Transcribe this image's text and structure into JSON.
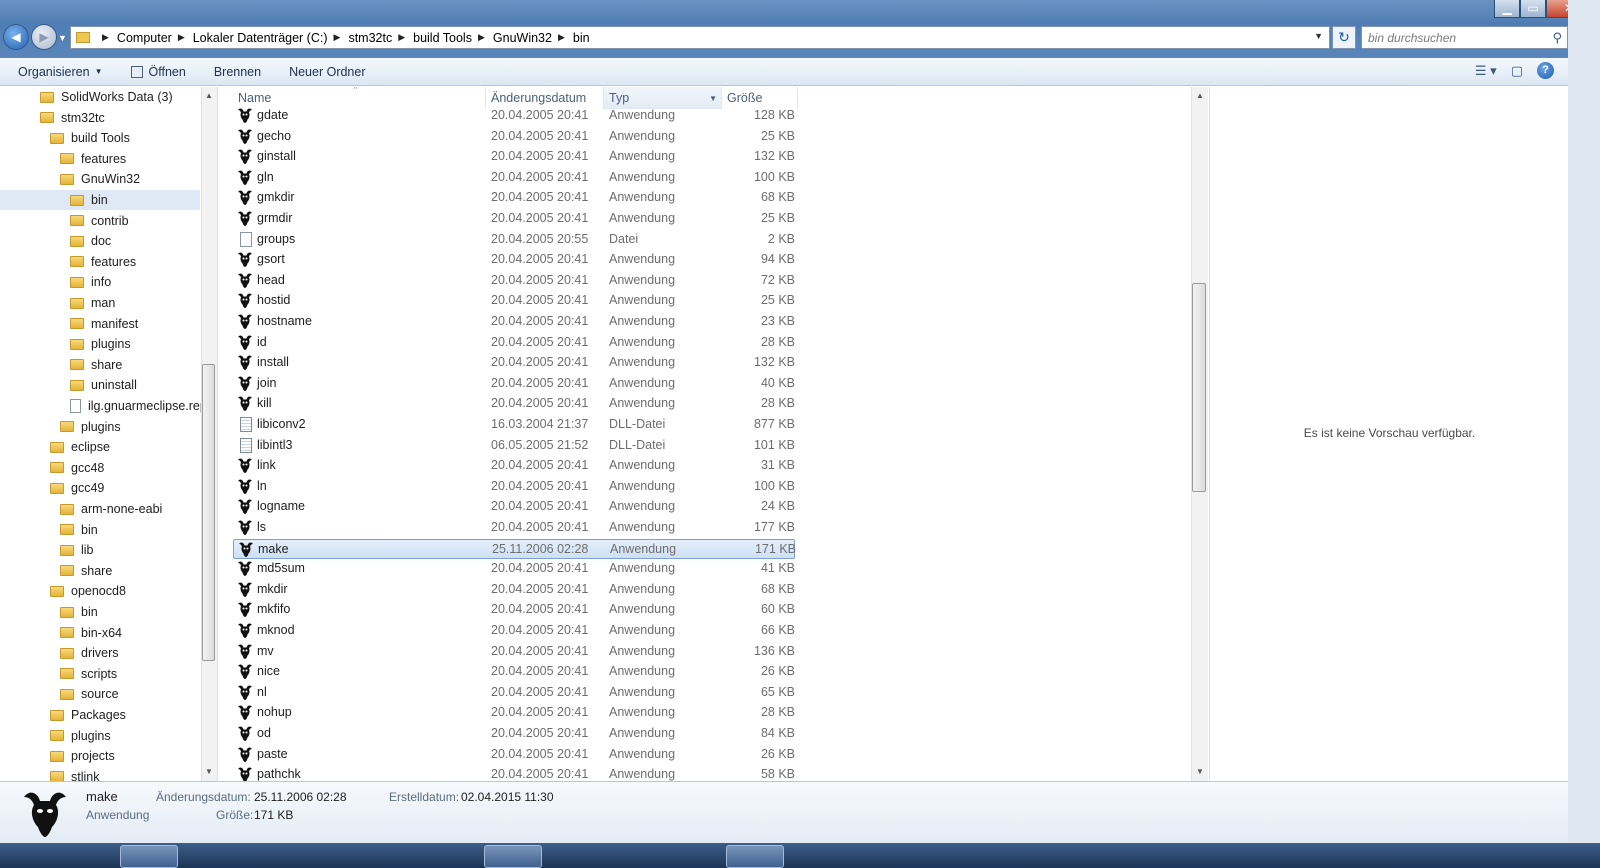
{
  "window": {
    "minimize": "▁",
    "maximize": "▭",
    "close": "✕"
  },
  "addressbar": {
    "crumbs": [
      "Computer",
      "Lokaler Datenträger (C:)",
      "stm32tc",
      "build Tools",
      "GnuWin32",
      "bin"
    ],
    "search_placeholder": "bin durchsuchen"
  },
  "toolbar": {
    "organize": "Organisieren",
    "open": "Öffnen",
    "burn": "Brennen",
    "new_folder": "Neuer Ordner"
  },
  "icons": {
    "back": "back-arrow-icon",
    "forward": "forward-arrow-icon",
    "refresh": "refresh-icon",
    "search": "search-icon",
    "views": "views-icon",
    "preview_pane": "preview-pane-icon",
    "help": "help-icon",
    "exe": "gnu-exe-icon",
    "folder": "folder-icon"
  },
  "nav_tree": [
    {
      "label": "SolidWorks Data (3)",
      "level": 0,
      "type": "folder"
    },
    {
      "label": "stm32tc",
      "level": 0,
      "type": "folder"
    },
    {
      "label": "build Tools",
      "level": 1,
      "type": "folder"
    },
    {
      "label": "features",
      "level": 2,
      "type": "folder"
    },
    {
      "label": "GnuWin32",
      "level": 2,
      "type": "folder"
    },
    {
      "label": "bin",
      "level": 3,
      "type": "folder",
      "selected": true
    },
    {
      "label": "contrib",
      "level": 3,
      "type": "folder"
    },
    {
      "label": "doc",
      "level": 3,
      "type": "folder"
    },
    {
      "label": "features",
      "level": 3,
      "type": "folder"
    },
    {
      "label": "info",
      "level": 3,
      "type": "folder"
    },
    {
      "label": "man",
      "level": 3,
      "type": "folder"
    },
    {
      "label": "manifest",
      "level": 3,
      "type": "folder"
    },
    {
      "label": "plugins",
      "level": 3,
      "type": "folder"
    },
    {
      "label": "share",
      "level": 3,
      "type": "folder"
    },
    {
      "label": "uninstall",
      "level": 3,
      "type": "folder"
    },
    {
      "label": "ilg.gnuarmeclipse.rep",
      "level": 3,
      "type": "file"
    },
    {
      "label": "plugins",
      "level": 2,
      "type": "folder"
    },
    {
      "label": "eclipse",
      "level": 1,
      "type": "folder"
    },
    {
      "label": "gcc48",
      "level": 1,
      "type": "folder"
    },
    {
      "label": "gcc49",
      "level": 1,
      "type": "folder"
    },
    {
      "label": "arm-none-eabi",
      "level": 2,
      "type": "folder"
    },
    {
      "label": "bin",
      "level": 2,
      "type": "folder"
    },
    {
      "label": "lib",
      "level": 2,
      "type": "folder"
    },
    {
      "label": "share",
      "level": 2,
      "type": "folder"
    },
    {
      "label": "openocd8",
      "level": 1,
      "type": "folder"
    },
    {
      "label": "bin",
      "level": 2,
      "type": "folder"
    },
    {
      "label": "bin-x64",
      "level": 2,
      "type": "folder"
    },
    {
      "label": "drivers",
      "level": 2,
      "type": "folder"
    },
    {
      "label": "scripts",
      "level": 2,
      "type": "folder"
    },
    {
      "label": "source",
      "level": 2,
      "type": "folder"
    },
    {
      "label": "Packages",
      "level": 1,
      "type": "folder"
    },
    {
      "label": "plugins",
      "level": 1,
      "type": "folder"
    },
    {
      "label": "projects",
      "level": 1,
      "type": "folder"
    },
    {
      "label": "stlink",
      "level": 1,
      "type": "folder"
    }
  ],
  "columns": {
    "name": "Name",
    "date": "Änderungsdatum",
    "type": "Typ",
    "size": "Größe"
  },
  "files": [
    {
      "name": "gdate",
      "date": "20.04.2005 20:41",
      "type": "Anwendung",
      "size": "128 KB",
      "icon": "exe"
    },
    {
      "name": "gecho",
      "date": "20.04.2005 20:41",
      "type": "Anwendung",
      "size": "25 KB",
      "icon": "exe"
    },
    {
      "name": "ginstall",
      "date": "20.04.2005 20:41",
      "type": "Anwendung",
      "size": "132 KB",
      "icon": "exe"
    },
    {
      "name": "gln",
      "date": "20.04.2005 20:41",
      "type": "Anwendung",
      "size": "100 KB",
      "icon": "exe"
    },
    {
      "name": "gmkdir",
      "date": "20.04.2005 20:41",
      "type": "Anwendung",
      "size": "68 KB",
      "icon": "exe"
    },
    {
      "name": "grmdir",
      "date": "20.04.2005 20:41",
      "type": "Anwendung",
      "size": "25 KB",
      "icon": "exe"
    },
    {
      "name": "groups",
      "date": "20.04.2005 20:55",
      "type": "Datei",
      "size": "2 KB",
      "icon": "file"
    },
    {
      "name": "gsort",
      "date": "20.04.2005 20:41",
      "type": "Anwendung",
      "size": "94 KB",
      "icon": "exe"
    },
    {
      "name": "head",
      "date": "20.04.2005 20:41",
      "type": "Anwendung",
      "size": "72 KB",
      "icon": "exe"
    },
    {
      "name": "hostid",
      "date": "20.04.2005 20:41",
      "type": "Anwendung",
      "size": "25 KB",
      "icon": "exe"
    },
    {
      "name": "hostname",
      "date": "20.04.2005 20:41",
      "type": "Anwendung",
      "size": "23 KB",
      "icon": "exe"
    },
    {
      "name": "id",
      "date": "20.04.2005 20:41",
      "type": "Anwendung",
      "size": "28 KB",
      "icon": "exe"
    },
    {
      "name": "install",
      "date": "20.04.2005 20:41",
      "type": "Anwendung",
      "size": "132 KB",
      "icon": "exe"
    },
    {
      "name": "join",
      "date": "20.04.2005 20:41",
      "type": "Anwendung",
      "size": "40 KB",
      "icon": "exe"
    },
    {
      "name": "kill",
      "date": "20.04.2005 20:41",
      "type": "Anwendung",
      "size": "28 KB",
      "icon": "exe"
    },
    {
      "name": "libiconv2",
      "date": "16.03.2004 21:37",
      "type": "DLL-Datei",
      "size": "877 KB",
      "icon": "dll"
    },
    {
      "name": "libintl3",
      "date": "06.05.2005 21:52",
      "type": "DLL-Datei",
      "size": "101 KB",
      "icon": "dll"
    },
    {
      "name": "link",
      "date": "20.04.2005 20:41",
      "type": "Anwendung",
      "size": "31 KB",
      "icon": "exe"
    },
    {
      "name": "ln",
      "date": "20.04.2005 20:41",
      "type": "Anwendung",
      "size": "100 KB",
      "icon": "exe"
    },
    {
      "name": "logname",
      "date": "20.04.2005 20:41",
      "type": "Anwendung",
      "size": "24 KB",
      "icon": "exe"
    },
    {
      "name": "ls",
      "date": "20.04.2005 20:41",
      "type": "Anwendung",
      "size": "177 KB",
      "icon": "exe"
    },
    {
      "name": "make",
      "date": "25.11.2006 02:28",
      "type": "Anwendung",
      "size": "171 KB",
      "icon": "exe",
      "selected": true
    },
    {
      "name": "md5sum",
      "date": "20.04.2005 20:41",
      "type": "Anwendung",
      "size": "41 KB",
      "icon": "exe"
    },
    {
      "name": "mkdir",
      "date": "20.04.2005 20:41",
      "type": "Anwendung",
      "size": "68 KB",
      "icon": "exe"
    },
    {
      "name": "mkfifo",
      "date": "20.04.2005 20:41",
      "type": "Anwendung",
      "size": "60 KB",
      "icon": "exe"
    },
    {
      "name": "mknod",
      "date": "20.04.2005 20:41",
      "type": "Anwendung",
      "size": "66 KB",
      "icon": "exe"
    },
    {
      "name": "mv",
      "date": "20.04.2005 20:41",
      "type": "Anwendung",
      "size": "136 KB",
      "icon": "exe"
    },
    {
      "name": "nice",
      "date": "20.04.2005 20:41",
      "type": "Anwendung",
      "size": "26 KB",
      "icon": "exe"
    },
    {
      "name": "nl",
      "date": "20.04.2005 20:41",
      "type": "Anwendung",
      "size": "65 KB",
      "icon": "exe"
    },
    {
      "name": "nohup",
      "date": "20.04.2005 20:41",
      "type": "Anwendung",
      "size": "28 KB",
      "icon": "exe"
    },
    {
      "name": "od",
      "date": "20.04.2005 20:41",
      "type": "Anwendung",
      "size": "84 KB",
      "icon": "exe"
    },
    {
      "name": "paste",
      "date": "20.04.2005 20:41",
      "type": "Anwendung",
      "size": "26 KB",
      "icon": "exe"
    },
    {
      "name": "pathchk",
      "date": "20.04.2005 20:41",
      "type": "Anwendung",
      "size": "58 KB",
      "icon": "exe"
    }
  ],
  "preview": {
    "empty_text": "Es ist keine Vorschau verfügbar."
  },
  "details": {
    "name": "make",
    "type": "Anwendung",
    "modified_label": "Änderungsdatum:",
    "modified_value": "25.11.2006 02:28",
    "size_label": "Größe:",
    "size_value": "171 KB",
    "created_label": "Erstelldatum:",
    "created_value": "02.04.2015 11:30"
  }
}
